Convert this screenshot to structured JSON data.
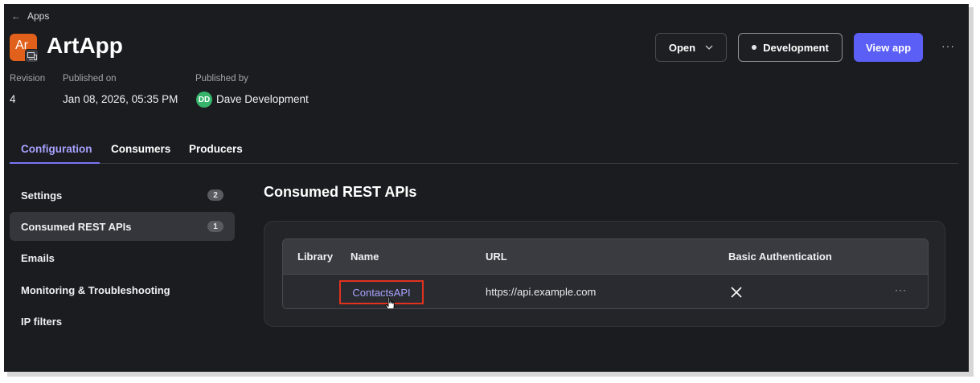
{
  "breadcrumb": {
    "label": "Apps"
  },
  "app": {
    "icon_abbr": "Ar",
    "title": "ArtApp"
  },
  "header_actions": {
    "open_label": "Open",
    "environment_label": "Development",
    "view_label": "View app",
    "more_label": "···"
  },
  "meta": {
    "revision_label": "Revision",
    "revision_value": "4",
    "published_on_label": "Published on",
    "published_on_value": "Jan 08, 2026, 05:35 PM",
    "published_by_label": "Published by",
    "published_by_initials": "DD",
    "published_by_value": "Dave Development"
  },
  "tabs": [
    {
      "label": "Configuration",
      "active": true
    },
    {
      "label": "Consumers",
      "active": false
    },
    {
      "label": "Producers",
      "active": false
    }
  ],
  "sidebar": {
    "items": [
      {
        "label": "Settings",
        "badge": "2",
        "active": false
      },
      {
        "label": "Consumed REST APIs",
        "badge": "1",
        "active": true
      },
      {
        "label": "Emails",
        "badge": "",
        "active": false
      },
      {
        "label": "Monitoring & Troubleshooting",
        "badge": "",
        "active": false
      },
      {
        "label": "IP filters",
        "badge": "",
        "active": false
      }
    ]
  },
  "main": {
    "section_title": "Consumed REST APIs",
    "table": {
      "columns": [
        "Library",
        "Name",
        "URL",
        "Basic Authentication"
      ],
      "rows": [
        {
          "library": "",
          "name": "ContactsAPI",
          "url": "https://api.example.com",
          "basic_auth": "x-icon",
          "more": "···"
        }
      ]
    }
  },
  "colors": {
    "accent": "#5b5ff5",
    "link": "#a7a3ff",
    "highlight_box": "#e0321f",
    "app_icon": "#e0601c",
    "avatar": "#37b46b"
  }
}
